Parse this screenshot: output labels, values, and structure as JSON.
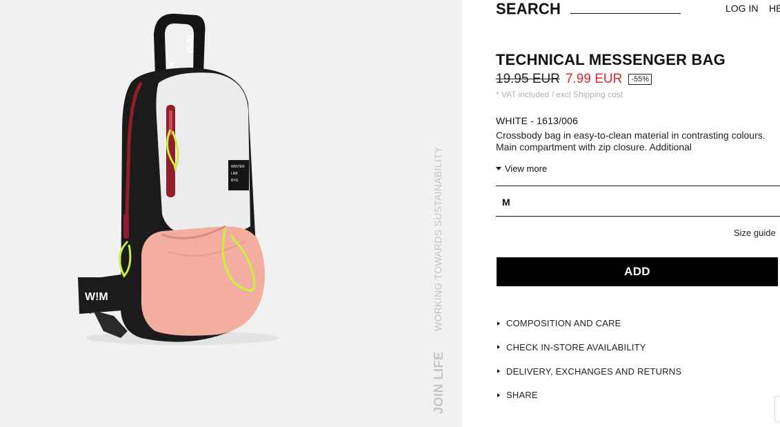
{
  "header": {
    "search_label": "SEARCH",
    "login_label": "LOG IN",
    "help_label": "HE"
  },
  "gallery": {
    "tagline": "WORKING TOWARDS SUSTAINABILITY",
    "join_life_logo": "JOIN LIFE",
    "bag_label_text": "WINTER LIMI BYG"
  },
  "product": {
    "title": "TECHNICAL MESSENGER BAG",
    "old_price": "19.95 EUR",
    "new_price": "7.99 EUR",
    "discount": "-55%",
    "vat_note": "* VAT included / excl Shipping cost",
    "color_ref": "WHITE - 1613/006",
    "description": "Crossbody bag in easy-to-clean material in contrasting colours. Main compartment with zip closure. Additional",
    "view_more_label": "View more"
  },
  "size_selector": {
    "selected": "M",
    "size_guide_label": "Size guide"
  },
  "add_button_label": "ADD",
  "info_links": [
    "COMPOSITION AND CARE",
    "CHECK IN-STORE AVAILABILITY",
    "DELIVERY, EXCHANGES AND RETURNS",
    "SHARE"
  ],
  "colors": {
    "sale_red": "#e8242b",
    "gallery_bg": "#f1f1f1",
    "button_black": "#000000",
    "bag_pink": "#f3aea0",
    "bag_white": "#ececec",
    "bag_black": "#1b1b1b",
    "cord_neon": "#c8f23a",
    "zip_red": "#8e1f2b"
  }
}
